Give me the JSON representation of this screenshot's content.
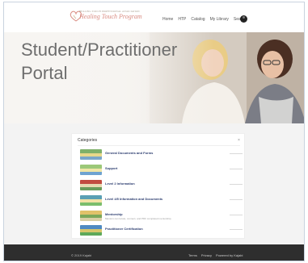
{
  "header": {
    "logo_tagline": "HEALING TOUCH PROFESSIONAL ASSOCIATION",
    "logo_name": "Healing Touch Program",
    "nav": [
      "Home",
      "HTP",
      "Catalog",
      "My Library",
      "Search"
    ]
  },
  "hero": {
    "title": "Student/Practitioner Portal"
  },
  "categories": {
    "title": "Categories",
    "close": "×",
    "items": [
      {
        "title": "General Documents and Forms",
        "description": "",
        "thumb_colors": [
          "#7fb06a",
          "#e8d88a",
          "#7aa6c9"
        ]
      },
      {
        "title": "Support",
        "description": "",
        "thumb_colors": [
          "#9cc878",
          "#f0e6a8",
          "#6fa3d1"
        ]
      },
      {
        "title": "Level 2 Information",
        "description": "",
        "thumb_colors": [
          "#c24b3f",
          "#e7d9b0",
          "#6a9c5a"
        ]
      },
      {
        "title": "Level 4/5 Information and Documents",
        "description": "",
        "thumb_colors": [
          "#5aa0b4",
          "#f1e2a6",
          "#7bbd6c"
        ]
      },
      {
        "title": "Mentorship",
        "description": "Mentors can locate, connect, and PDF completed mentorship.",
        "thumb_colors": [
          "#e1c26a",
          "#7ba85a",
          "#d9cfa5"
        ]
      },
      {
        "title": "Practitioner Certification",
        "description": "",
        "thumb_colors": [
          "#4f8ac2",
          "#d7c76c",
          "#5ea95a"
        ]
      }
    ]
  },
  "footer": {
    "copyright": "© 2019 Kajabi",
    "links": [
      "Terms",
      "Privacy",
      "Powered by Kajabi"
    ]
  }
}
